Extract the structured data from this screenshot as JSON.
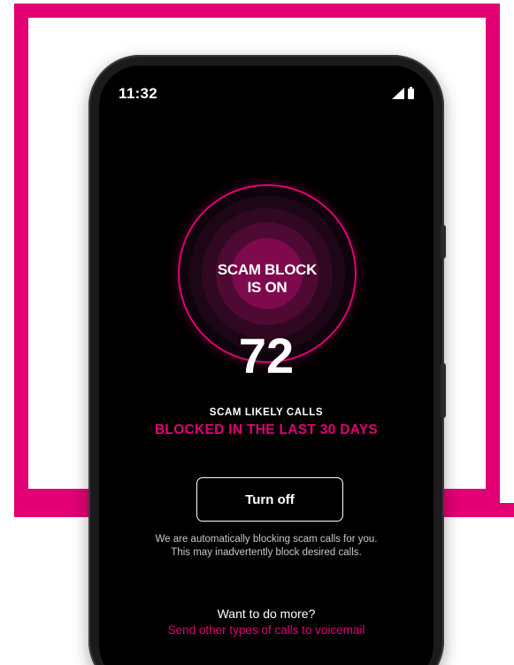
{
  "status_bar": {
    "time": "11:32",
    "icons": [
      "signal-icon",
      "battery-icon"
    ]
  },
  "scam_block": {
    "status_line1": "SCAM BLOCK",
    "status_line2": "IS ON",
    "count": "72",
    "caption_top": "SCAM LIKELY CALLS",
    "caption_bottom": "BLOCKED IN THE LAST 30 DAYS"
  },
  "actions": {
    "turn_off_label": "Turn off",
    "disclaimer": "We are automatically blocking scam calls for you. This may inadvertently block desired calls."
  },
  "more": {
    "title": "Want to do more?",
    "link": "Send other types of calls to voicemail"
  },
  "colors": {
    "brand_magenta": "#e20074",
    "screen_background": "#000000",
    "text_primary": "#ffffff",
    "text_secondary": "#c8c8c8"
  }
}
